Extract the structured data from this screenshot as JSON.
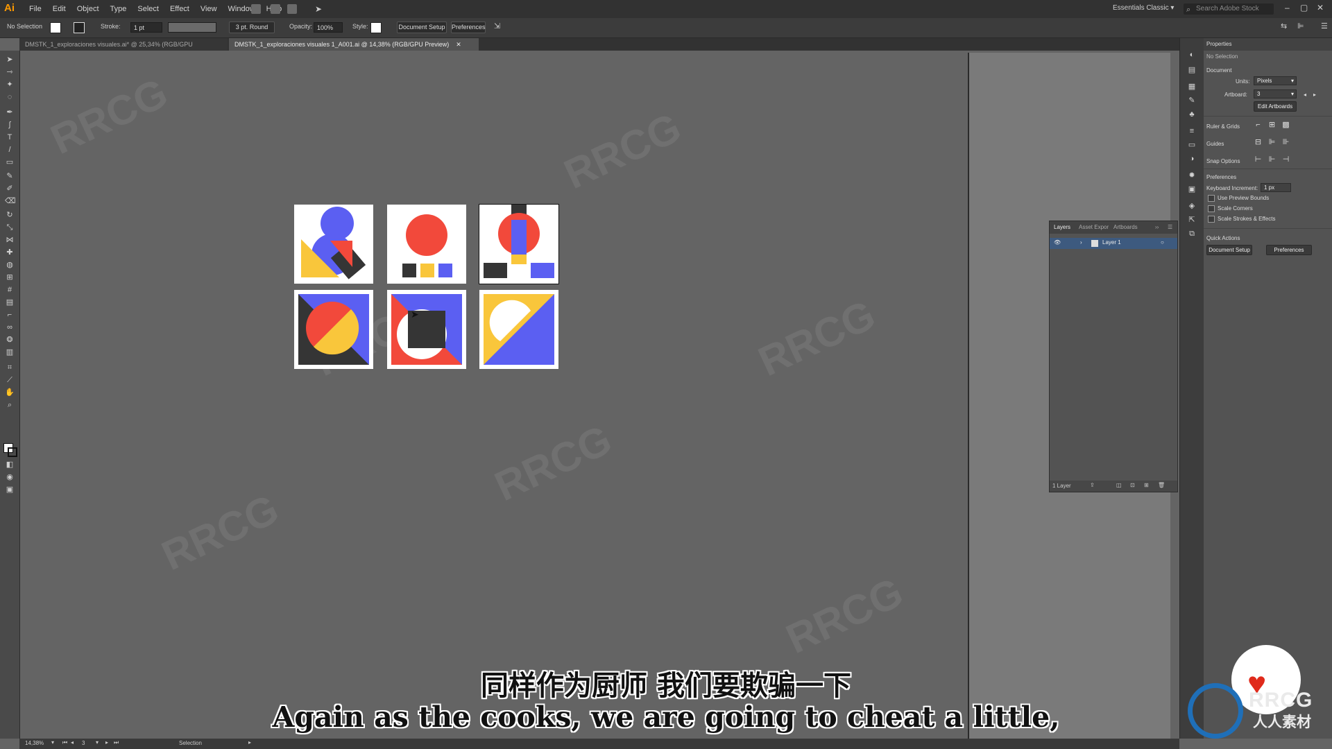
{
  "app": {
    "logo": "Ai"
  },
  "menu": [
    "File",
    "Edit",
    "Object",
    "Type",
    "Select",
    "Effect",
    "View",
    "Window",
    "Help"
  ],
  "workspace": "Essentials Classic",
  "search_placeholder": "Search Adobe Stock",
  "control_bar": {
    "selection": "No Selection",
    "stroke_label": "Stroke:",
    "stroke_value": "1 pt",
    "brush": "3 pt. Round",
    "opacity_label": "Opacity:",
    "opacity_value": "100%",
    "style_label": "Style:",
    "document_setup": "Document Setup",
    "preferences": "Preferences"
  },
  "tabs": [
    {
      "label": "DMSTK_1_exploraciones visuales.ai* @ 25,34% (RGB/GPU Preview)"
    },
    {
      "label": "DMSTK_1_exploraciones visuales 1_A001.ai @ 14,38% (RGB/GPU Preview)"
    }
  ],
  "colors": {
    "blue": "#5b5ff2",
    "red": "#f2493b",
    "yellow": "#f9c63b",
    "dark": "#353535"
  },
  "layers_panel": {
    "tabs": [
      "Layers",
      "Asset Expor",
      "Artboards"
    ],
    "layer_name": "Layer 1",
    "footer": "1 Layer"
  },
  "properties": {
    "title": "Properties",
    "selection": "No Selection",
    "document": "Document",
    "units_label": "Units:",
    "units_value": "Pixels",
    "artboard_label": "Artboard:",
    "artboard_value": "3",
    "edit_artboards": "Edit Artboards",
    "rulers_grids": "Ruler & Grids",
    "guides": "Guides",
    "snap_options": "Snap Options",
    "preferences": "Preferences",
    "keyboard_increment_label": "Keyboard Increment:",
    "keyboard_increment_value": "1 px",
    "use_preview_bounds": "Use Preview Bounds",
    "scale_corners": "Scale Corners",
    "scale_strokes": "Scale Strokes & Effects",
    "quick_actions": "Quick Actions",
    "document_setup_btn": "Document Setup",
    "preferences_btn": "Preferences"
  },
  "status": {
    "zoom": "14,38%",
    "artboard": "3",
    "tool": "Selection"
  },
  "subtitles": {
    "cn": "同样作为厨师 我们要欺骗一下",
    "en": "Again as the cooks, we are going to cheat a little,"
  },
  "watermark": {
    "text": "RRCG",
    "sub": "人人素材"
  }
}
